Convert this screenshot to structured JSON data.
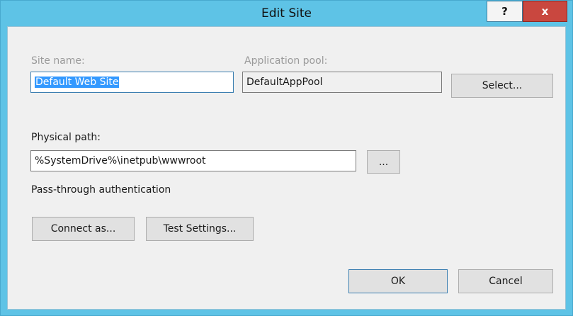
{
  "window": {
    "title": "Edit Site",
    "help_label": "?",
    "close_label": "x"
  },
  "site_name": {
    "label": "Site name:",
    "value": "Default Web Site"
  },
  "application_pool": {
    "label": "Application pool:",
    "value": "DefaultAppPool",
    "select_label": "Select..."
  },
  "physical_path": {
    "label": "Physical path:",
    "value": "%SystemDrive%\\inetpub\\wwwroot",
    "browse_label": "..."
  },
  "auth": {
    "label": "Pass-through authentication",
    "connect_as_label": "Connect as...",
    "test_settings_label": "Test Settings..."
  },
  "footer": {
    "ok_label": "OK",
    "cancel_label": "Cancel"
  },
  "colors": {
    "title_bar": "#5ec3e6",
    "close_button": "#c9473f",
    "selection": "#3399ff",
    "client_background": "#f0f0f0"
  }
}
